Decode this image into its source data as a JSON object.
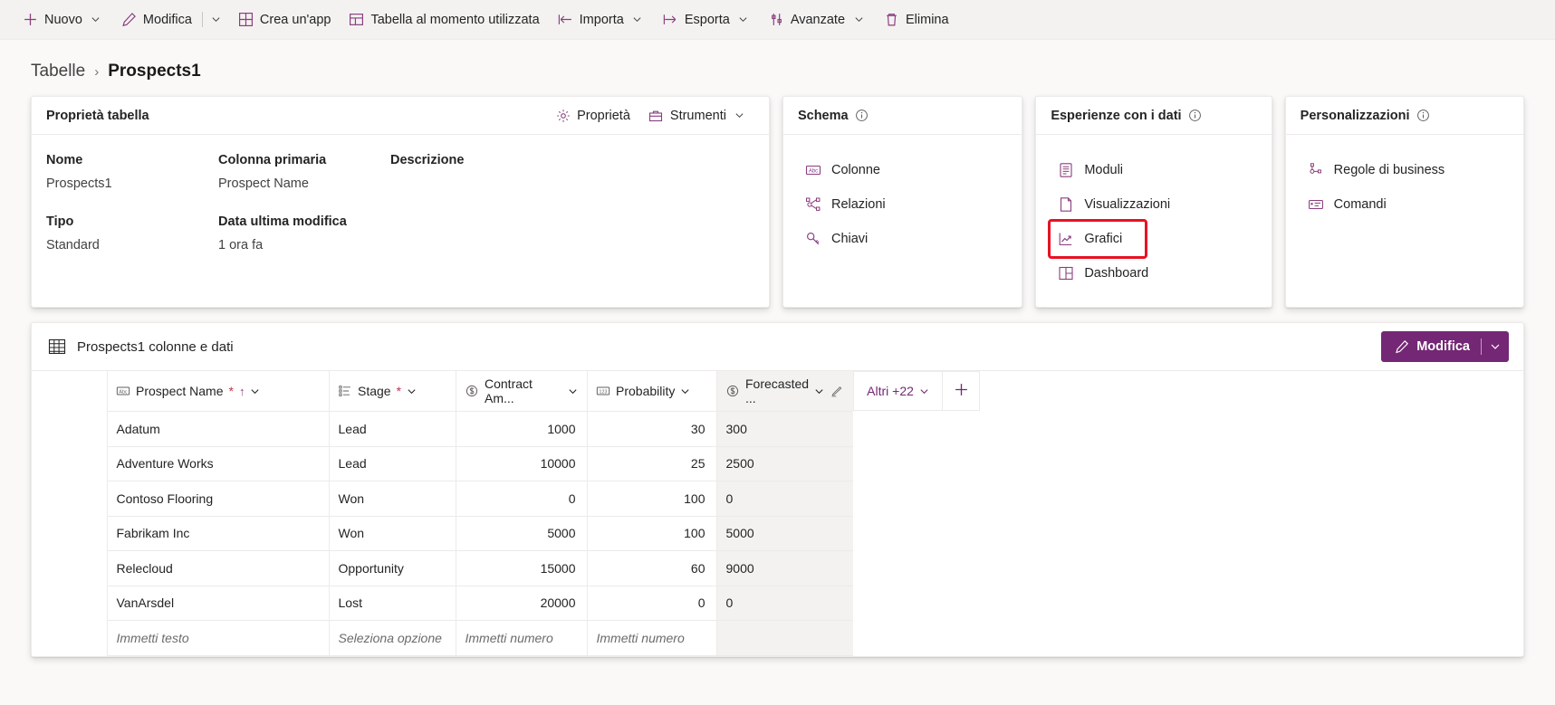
{
  "commandbar": {
    "items": [
      {
        "label": "Nuovo",
        "icon": "plus-icon",
        "caret": true,
        "split": false
      },
      {
        "label": "Modifica",
        "icon": "pencil-icon",
        "caret": true,
        "split": true
      },
      {
        "label": "Crea un'app",
        "icon": "app-grid-icon",
        "caret": false,
        "split": false
      },
      {
        "label": "Tabella al momento utilizzata",
        "icon": "table-used-icon",
        "caret": false,
        "split": false
      },
      {
        "label": "Importa",
        "icon": "import-icon",
        "caret": true,
        "split": false
      },
      {
        "label": "Esporta",
        "icon": "export-icon",
        "caret": true,
        "split": false
      },
      {
        "label": "Avanzate",
        "icon": "advanced-icon",
        "caret": true,
        "split": false
      },
      {
        "label": "Elimina",
        "icon": "trash-icon",
        "caret": false,
        "split": false
      }
    ]
  },
  "breadcrumb": {
    "root": "Tabelle",
    "separator": "›",
    "current": "Prospects1"
  },
  "properties_card": {
    "title": "Proprietà tabella",
    "actions": [
      {
        "label": "Proprietà",
        "icon": "gear-icon",
        "caret": false
      },
      {
        "label": "Strumenti",
        "icon": "toolbox-icon",
        "caret": true
      }
    ],
    "labels": {
      "name": "Nome",
      "primary_column": "Colonna primaria",
      "description": "Descrizione",
      "type": "Tipo",
      "last_modified": "Data ultima modifica"
    },
    "values": {
      "name": "Prospects1",
      "primary_column": "Prospect Name",
      "description": "",
      "type": "Standard",
      "last_modified": "1 ora fa"
    }
  },
  "schema_card": {
    "title": "Schema",
    "items": [
      {
        "label": "Colonne",
        "icon": "abc-icon"
      },
      {
        "label": "Relazioni",
        "icon": "relationships-icon"
      },
      {
        "label": "Chiavi",
        "icon": "key-icon"
      }
    ]
  },
  "data_experiences_card": {
    "title": "Esperienze con i dati",
    "items": [
      {
        "label": "Moduli",
        "icon": "form-icon",
        "highlighted": false
      },
      {
        "label": "Visualizzazioni",
        "icon": "view-icon",
        "highlighted": false
      },
      {
        "label": "Grafici",
        "icon": "chart-icon",
        "highlighted": true
      },
      {
        "label": "Dashboard",
        "icon": "dashboard-icon",
        "highlighted": false
      }
    ]
  },
  "customizations_card": {
    "title": "Personalizzazioni",
    "items": [
      {
        "label": "Regole di business",
        "icon": "business-rules-icon"
      },
      {
        "label": "Comandi",
        "icon": "commands-icon"
      }
    ]
  },
  "data_grid": {
    "header_title": "Prospects1 colonne e dati",
    "edit_button": {
      "label": "Modifica",
      "icon": "pencil-icon"
    },
    "columns": [
      {
        "label": "Prospect Name",
        "icon": "abc-icon",
        "required": true,
        "sorted": true,
        "caret": true
      },
      {
        "label": "Stage",
        "icon": "choice-icon",
        "required": true,
        "sorted": false,
        "caret": true
      },
      {
        "label": "Contract Am...",
        "icon": "currency-icon",
        "required": false,
        "sorted": false,
        "caret": true
      },
      {
        "label": "Probability",
        "icon": "number-icon",
        "required": false,
        "sorted": false,
        "caret": true
      },
      {
        "label": "Forecasted ...",
        "icon": "currency-icon",
        "required": false,
        "sorted": false,
        "caret": true,
        "locked": true,
        "selected": true
      }
    ],
    "more_columns": {
      "label": "Altri +22",
      "caret": true
    },
    "add_column": {
      "label": "",
      "icon": "plus-icon"
    },
    "rows": [
      {
        "name": "Adatum",
        "stage": "Lead",
        "amount": "1000",
        "probability": "30",
        "forecasted": "300"
      },
      {
        "name": "Adventure Works",
        "stage": "Lead",
        "amount": "10000",
        "probability": "25",
        "forecasted": "2500"
      },
      {
        "name": "Contoso Flooring",
        "stage": "Won",
        "amount": "0",
        "probability": "100",
        "forecasted": "0"
      },
      {
        "name": "Fabrikam Inc",
        "stage": "Won",
        "amount": "5000",
        "probability": "100",
        "forecasted": "5000"
      },
      {
        "name": "Relecloud",
        "stage": "Opportunity",
        "amount": "15000",
        "probability": "60",
        "forecasted": "9000"
      },
      {
        "name": "VanArsdel",
        "stage": "Lost",
        "amount": "20000",
        "probability": "0",
        "forecasted": "0"
      }
    ],
    "new_row": {
      "name": "Immetti testo",
      "stage": "Seleziona opzione",
      "amount": "Immetti numero",
      "probability": "Immetti numero",
      "forecasted": ""
    }
  },
  "colors": {
    "accent": "#742774",
    "icon_accent": "#8a3d7e",
    "highlight": "#e81123",
    "required": "#c4314b",
    "page_bg": "#faf9f8",
    "cmdbar_bg": "#f3f2f1"
  }
}
